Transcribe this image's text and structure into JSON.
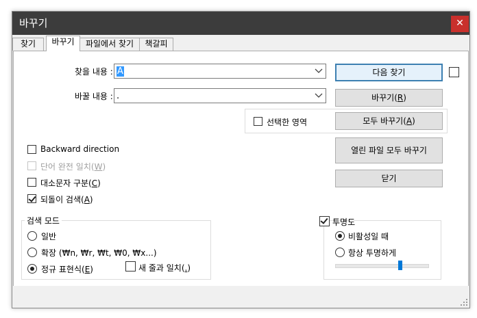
{
  "window": {
    "title": "바꾸기",
    "close_symbol": "✕"
  },
  "tabs": [
    {
      "label": "찾기"
    },
    {
      "label": "바꾸기"
    },
    {
      "label": "파일에서 찾기"
    },
    {
      "label": "책갈피"
    }
  ],
  "find": {
    "label": "찾을 내용 :",
    "value": "A"
  },
  "replace": {
    "label": "바꿀 내용 :",
    "value": "."
  },
  "buttons": {
    "find_next": "다음 찾기",
    "replace": "바꾸기(R)",
    "replace_all": "모두 바꾸기(A)",
    "replace_all_open": "열린 파일 모두 바꾸기",
    "close": "닫기"
  },
  "selection": {
    "label": "선택한 영역",
    "checked": false
  },
  "options": [
    {
      "label": "Backward direction",
      "checked": false,
      "disabled": false
    },
    {
      "label": "단어 완전 일치(W)",
      "checked": false,
      "disabled": true
    },
    {
      "label": "대소문자 구분(C)",
      "checked": false,
      "disabled": false
    },
    {
      "label": "되돌이 검색(A)",
      "checked": true,
      "disabled": false
    }
  ],
  "search_mode": {
    "title": "검색 모드",
    "options": [
      {
        "label": "일반",
        "checked": false
      },
      {
        "label": "확장 (₩n, ₩r, ₩t, ₩0, ₩x...)",
        "checked": false
      },
      {
        "label": "정규 표현식(E)",
        "checked": true
      }
    ],
    "newline_match": {
      "label": "새 줄과 일치(.)",
      "checked": false
    }
  },
  "transparency": {
    "title": "투명도",
    "checked": true,
    "options": [
      {
        "label": "비활성일 때",
        "checked": true
      },
      {
        "label": "항상 투명하게",
        "checked": false
      }
    ],
    "slider_fraction": 0.7
  },
  "colors": {
    "titlebar": "#3c3c3c",
    "close": "#c9302c",
    "accent": "#0078d7"
  }
}
